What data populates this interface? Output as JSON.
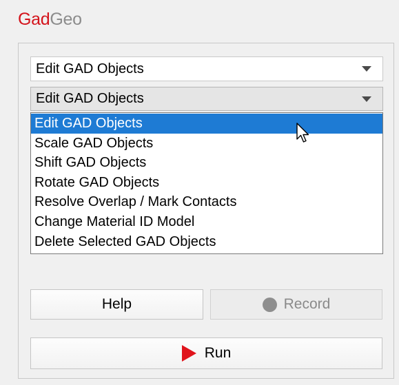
{
  "app": {
    "title_part1": "Gad",
    "title_part2": "Geo",
    "brand_color": "#d4141c"
  },
  "combo_top": {
    "value": "Edit GAD Objects"
  },
  "combo_open": {
    "value": "Edit GAD Objects"
  },
  "dropdown": {
    "items": [
      "Edit GAD Objects",
      "Scale GAD Objects",
      "Shift GAD Objects",
      "Rotate GAD Objects",
      "Resolve Overlap / Mark Contacts",
      "Change Material ID Model",
      "Delete Selected GAD Objects"
    ],
    "selected": "Edit GAD Objects",
    "highlight_color": "#1e7bd4"
  },
  "buttons": {
    "help": "Help",
    "record": "Record",
    "run": "Run"
  },
  "icons": {
    "record": "record-icon",
    "run": "play-icon",
    "cursor": "mouse-cursor-icon"
  }
}
